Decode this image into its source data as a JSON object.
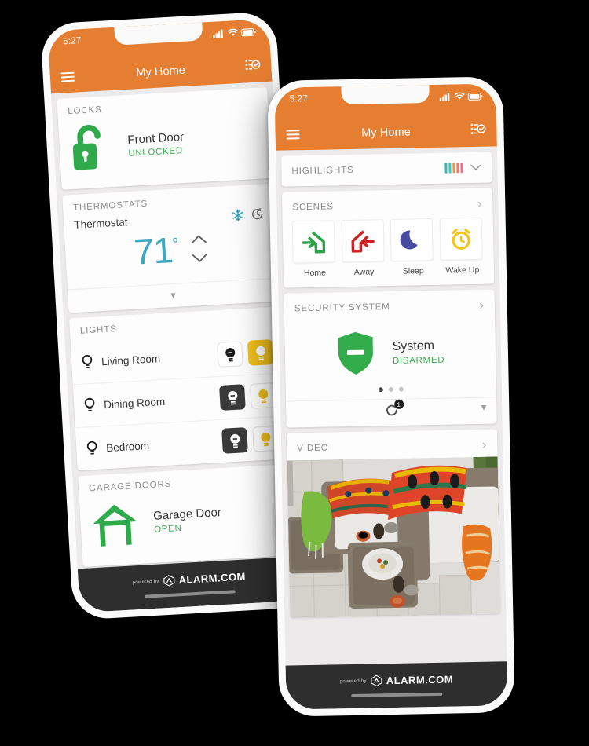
{
  "theme": {
    "orange": "#e67e32",
    "green": "#3aab4f",
    "teal": "#3ba9c4",
    "yellow": "#f0c01d",
    "dark": "#3a3a3a",
    "screen_bg": "#eceaea"
  },
  "phone_back": {
    "status": {
      "time": "5:27",
      "signal_icon": "cellular-signal-icon",
      "wifi_icon": "wifi-icon",
      "battery_icon": "battery-icon"
    },
    "nav": {
      "menu_icon": "hamburger-menu-icon",
      "title": "My Home",
      "right_icon": "activity-checklist-icon"
    },
    "locks": {
      "header": "LOCKS",
      "icon": "open-padlock-icon",
      "name": "Front Door",
      "state": "UNLOCKED"
    },
    "thermostats": {
      "header": "THERMOSTATS",
      "name": "Thermostat",
      "mode_icon": "snowflake-icon",
      "schedule_icon": "clock-reset-icon",
      "temperature": "71",
      "degree": "°",
      "up_icon": "chevron-up-icon",
      "down_icon": "chevron-down-icon",
      "expand_icon": "chevron-down-icon"
    },
    "lights": {
      "header": "LIGHTS",
      "rows": [
        {
          "icon": "bulb-outline-icon",
          "name": "Living Room",
          "off_state": "off",
          "on_state": "on"
        },
        {
          "icon": "bulb-outline-icon",
          "name": "Dining Room",
          "off_state": "dark",
          "on_state": "off"
        },
        {
          "icon": "bulb-outline-icon",
          "name": "Bedroom",
          "off_state": "dark",
          "on_state": "off"
        }
      ]
    },
    "garage": {
      "header": "GARAGE DOORS",
      "icon": "garage-open-icon",
      "name": "Garage Door",
      "state": "OPEN"
    },
    "footer": {
      "powered": "powered by",
      "brand": "ALARM.COM",
      "logo_icon": "alarm-com-logo-icon"
    }
  },
  "phone_front": {
    "status": {
      "time": "5:27",
      "signal_icon": "cellular-signal-icon",
      "wifi_icon": "wifi-icon",
      "battery_icon": "battery-icon"
    },
    "nav": {
      "menu_icon": "hamburger-menu-icon",
      "title": "My Home",
      "right_icon": "activity-checklist-icon"
    },
    "highlights": {
      "header": "HIGHLIGHTS",
      "bars_icon": "bar-chart-icon",
      "bar_colors": [
        "#37b7b7",
        "#3fc4c0",
        "#f0954a",
        "#f2796f",
        "#ef6f8e"
      ],
      "collapse_icon": "chevron-down-icon"
    },
    "scenes": {
      "header": "SCENES",
      "more_icon": "chevron-right-icon",
      "items": [
        {
          "label": "Home",
          "icon": "arrow-into-house-icon",
          "color": "#2aa446"
        },
        {
          "label": "Away",
          "icon": "arrow-out-of-house-icon",
          "color": "#cf2222"
        },
        {
          "label": "Sleep",
          "icon": "crescent-moon-icon",
          "color": "#474a9e"
        },
        {
          "label": "Wake Up",
          "icon": "alarm-clock-icon",
          "color": "#f2c319"
        }
      ]
    },
    "security": {
      "header": "SECURITY SYSTEM",
      "more_icon": "chevron-right-icon",
      "shield_icon": "shield-disarmed-icon",
      "name": "System",
      "state": "DISARMED",
      "page_dots": 3,
      "active_dot": 1,
      "refresh_icon": "refresh-icon",
      "badge_count": "1",
      "collapse_icon": "chevron-down-icon"
    },
    "video": {
      "header": "VIDEO",
      "more_icon": "chevron-right-icon",
      "thumbnail_alt": "outdoor patio lounge camera feed"
    },
    "footer": {
      "powered": "powered by",
      "brand": "ALARM.COM",
      "logo_icon": "alarm-com-logo-icon"
    }
  }
}
